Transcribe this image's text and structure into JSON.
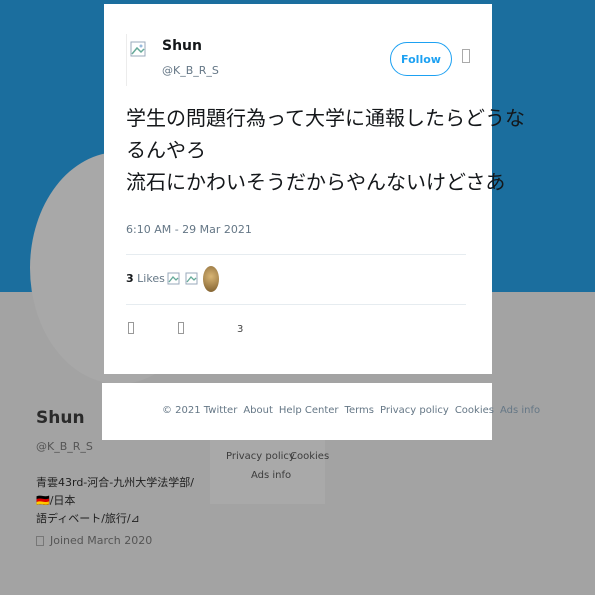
{
  "tweet": {
    "author_name": "Shun",
    "author_handle": "@K_B_R_S",
    "follow_label": "Follow",
    "text_lines": [
      "学生の問題行為って大学に通報したらどうな",
      "るんやろ",
      "流石にかわいそうだからやんないけどさあ"
    ],
    "timestamp": "6:10 AM - 29 Mar 2021",
    "likes_count": "3",
    "likes_label": "Likes",
    "action_count": "3"
  },
  "footer": {
    "links": [
      "© 2021 Twitter",
      "About",
      "Help Center",
      "Terms",
      "Privacy policy",
      "Cookies",
      "Ads info"
    ]
  },
  "profile": {
    "name": "Shun",
    "handle": "@K_B_R_S",
    "bio_line1": "青雲43rd-河合-九州大学法学部/🇩🇪/日本",
    "bio_line2": "語ディベート/旅行/⊿",
    "joined": "Joined March 2020",
    "footer_card": [
      "Privacy policy",
      "Cookies",
      "Ads info"
    ]
  },
  "colors": {
    "banner": "#1b6e9e",
    "accent": "#1da1f2",
    "overlay_gray": "#a3a3a3"
  },
  "icons": {
    "default_avatar": "broken-image-icon",
    "more": "more-icon",
    "reply": "reply-icon",
    "retweet": "retweet-icon",
    "calendar": "calendar-icon"
  }
}
